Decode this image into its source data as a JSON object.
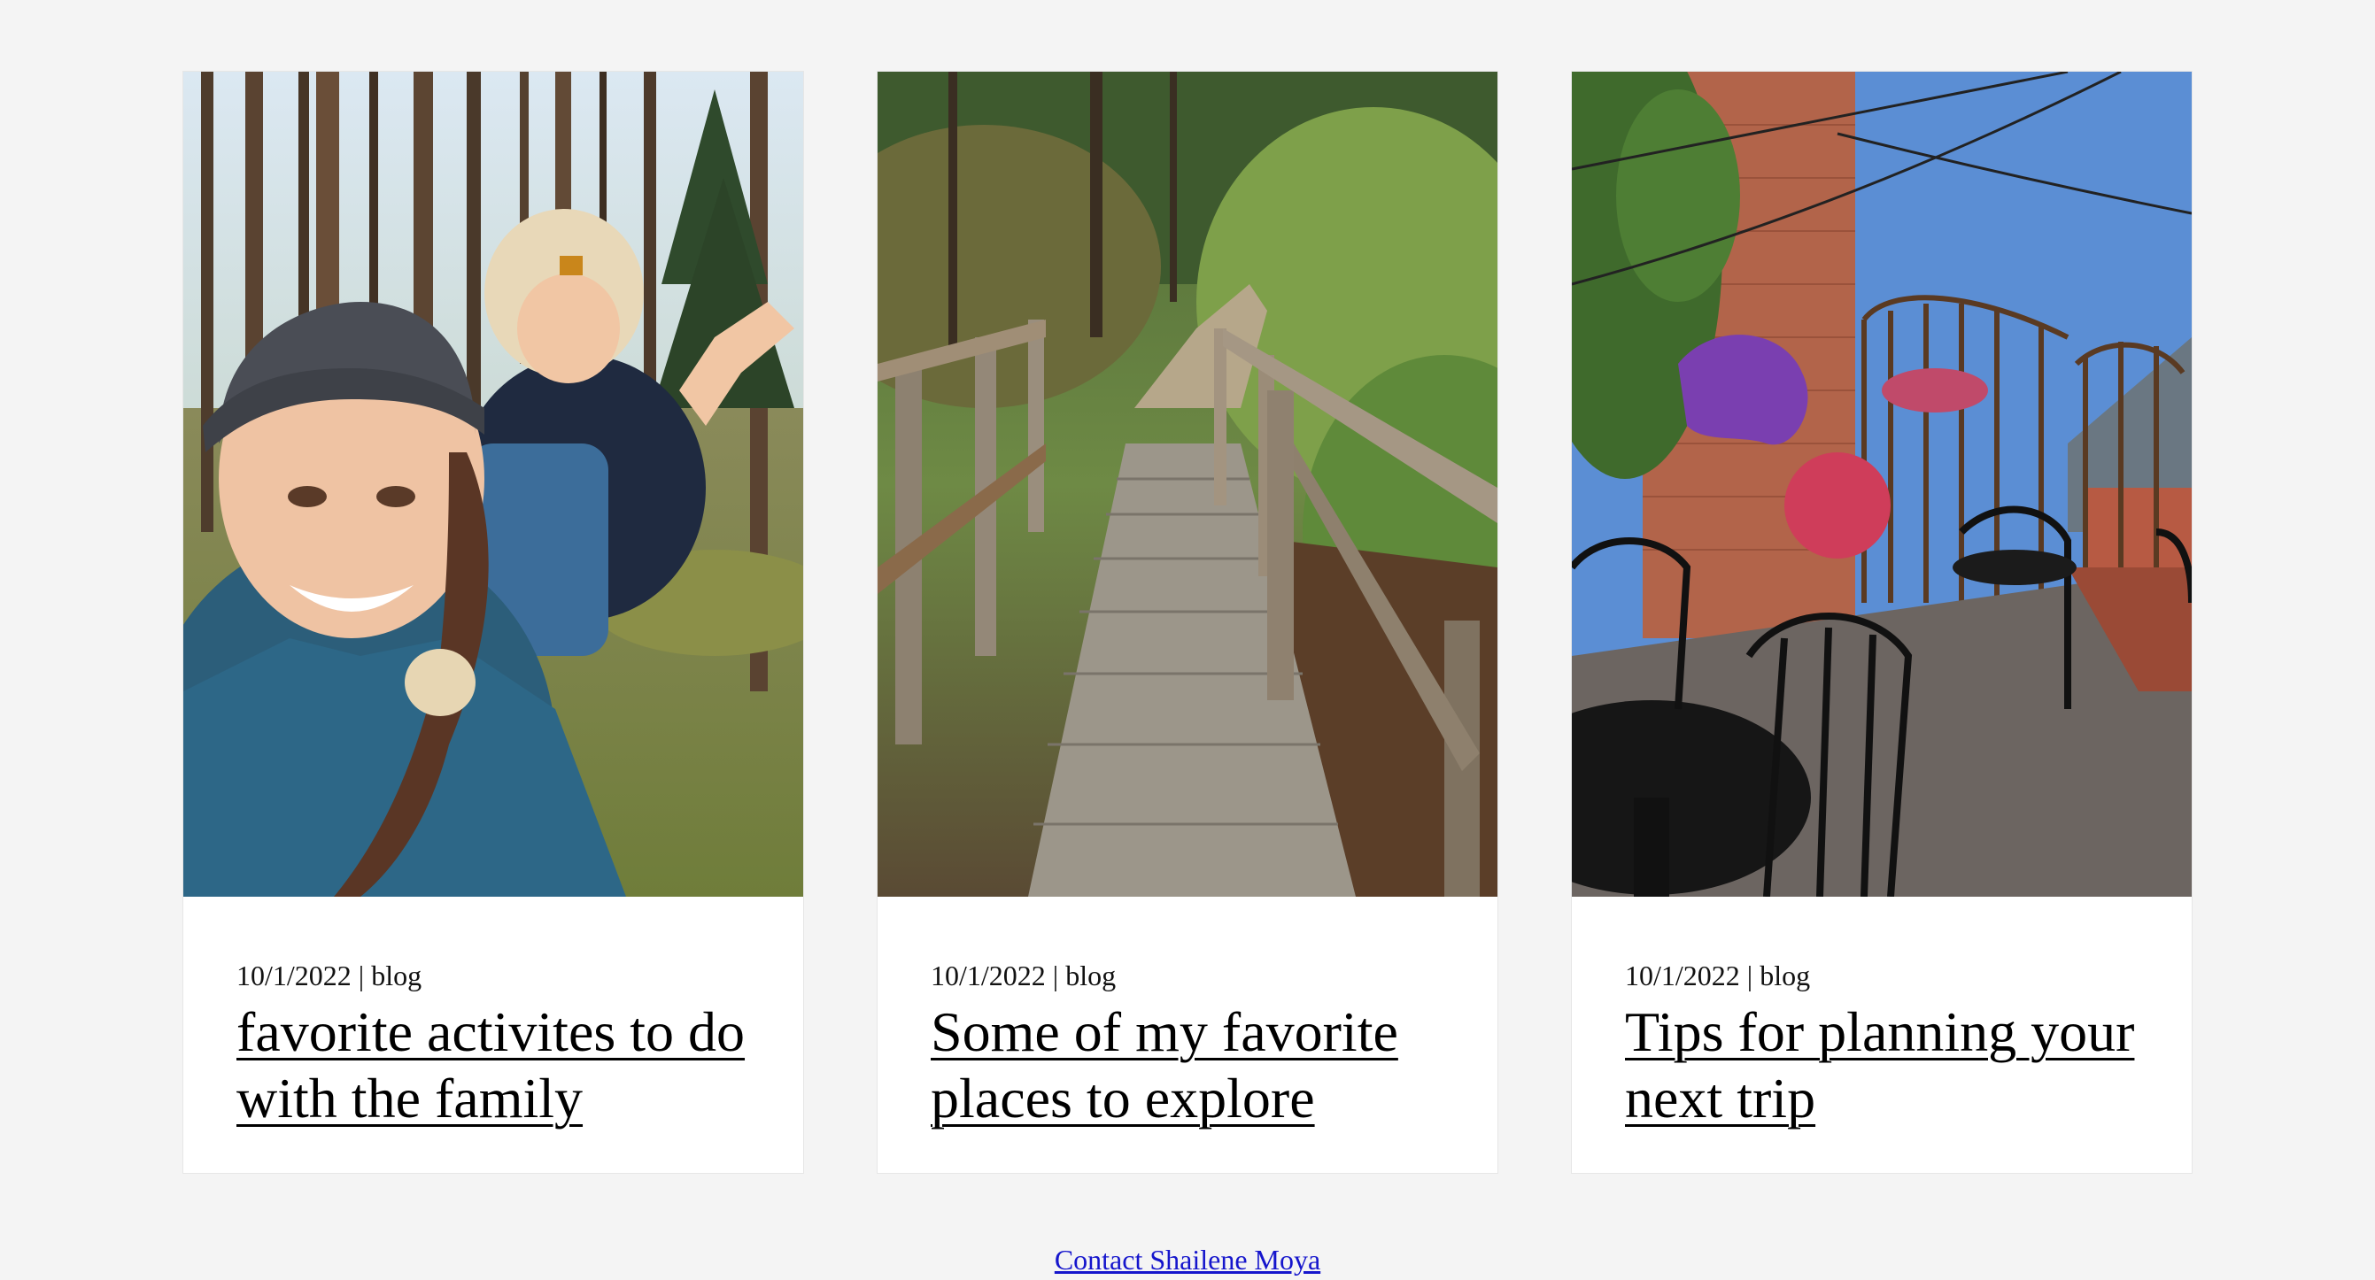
{
  "posts": [
    {
      "date": "10/1/2022",
      "separator": "|",
      "category": "blog",
      "title": "favorite activites to do with the family",
      "image": "family-hike-selfie"
    },
    {
      "date": "10/1/2022",
      "separator": "|",
      "category": "blog",
      "title": "Some of my favorite places to explore",
      "image": "wooden-footbridge"
    },
    {
      "date": "10/1/2022",
      "separator": "|",
      "category": "blog",
      "title": "Tips for planning your next trip",
      "image": "rooftop-patio"
    }
  ],
  "footer": {
    "contact_label": "Contact Shailene Moya"
  }
}
